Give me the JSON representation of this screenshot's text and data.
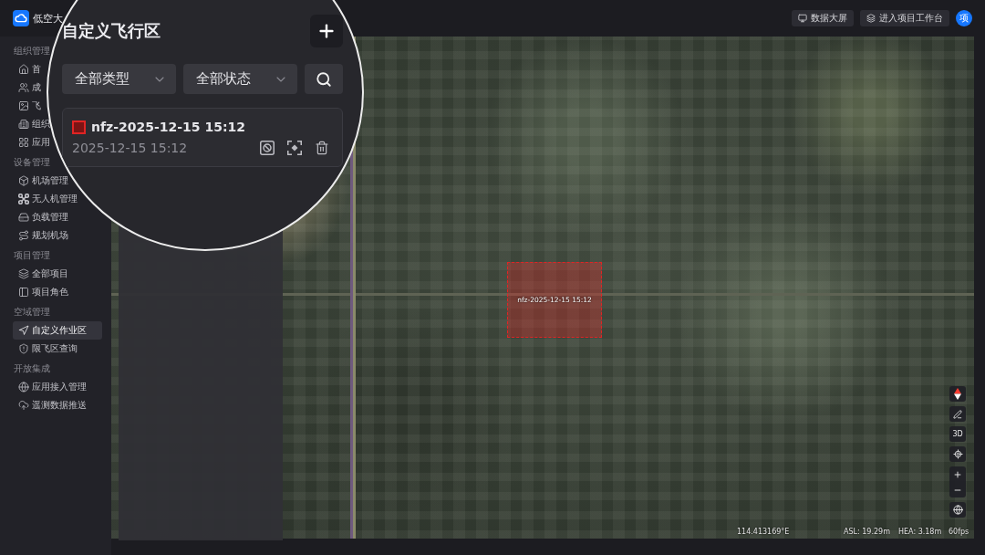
{
  "app": {
    "name": "低空大"
  },
  "header": {
    "actions": [
      {
        "label": "数据大屏"
      },
      {
        "label": "进入项目工作台"
      }
    ],
    "avatar": "项"
  },
  "sidebar": {
    "groups": [
      {
        "title": "组织管理",
        "items": [
          {
            "label": "首",
            "selected": false
          },
          {
            "label": "成",
            "selected": false
          },
          {
            "label": "飞",
            "selected": false
          },
          {
            "label": "组织",
            "selected": false
          },
          {
            "label": "应用",
            "selected": false
          }
        ]
      },
      {
        "title": "设备管理",
        "items": [
          {
            "label": "机场管理",
            "selected": false
          },
          {
            "label": "无人机管理",
            "selected": false
          },
          {
            "label": "负载管理",
            "selected": false
          },
          {
            "label": "规划机场",
            "selected": false
          }
        ]
      },
      {
        "title": "项目管理",
        "items": [
          {
            "label": "全部项目",
            "selected": false
          },
          {
            "label": "项目角色",
            "selected": false
          }
        ]
      },
      {
        "title": "空域管理",
        "items": [
          {
            "label": "自定义作业区",
            "selected": true
          },
          {
            "label": "限飞区查询",
            "selected": false
          }
        ]
      },
      {
        "title": "开放集成",
        "items": [
          {
            "label": "应用接入管理",
            "selected": false
          },
          {
            "label": "遥测数据推送",
            "selected": false
          }
        ]
      }
    ]
  },
  "panel": {
    "title": "自定义飞行区",
    "filters": [
      {
        "value": "全部类型"
      },
      {
        "value": "全部状态"
      }
    ],
    "zones": [
      {
        "name": "nfz-2025-12-15 15:12",
        "date": "2025-12-15 15:12",
        "color": "#e02424"
      }
    ]
  },
  "map": {
    "zones": [
      {
        "label": "nfz-2025-12-15 15:12"
      }
    ],
    "view_mode": "3D",
    "status": {
      "longitude": "114.413169°E",
      "altitude": "ASL: 19.29m",
      "height": "HEA: 3.18m",
      "frame_rate": "60fps"
    }
  }
}
